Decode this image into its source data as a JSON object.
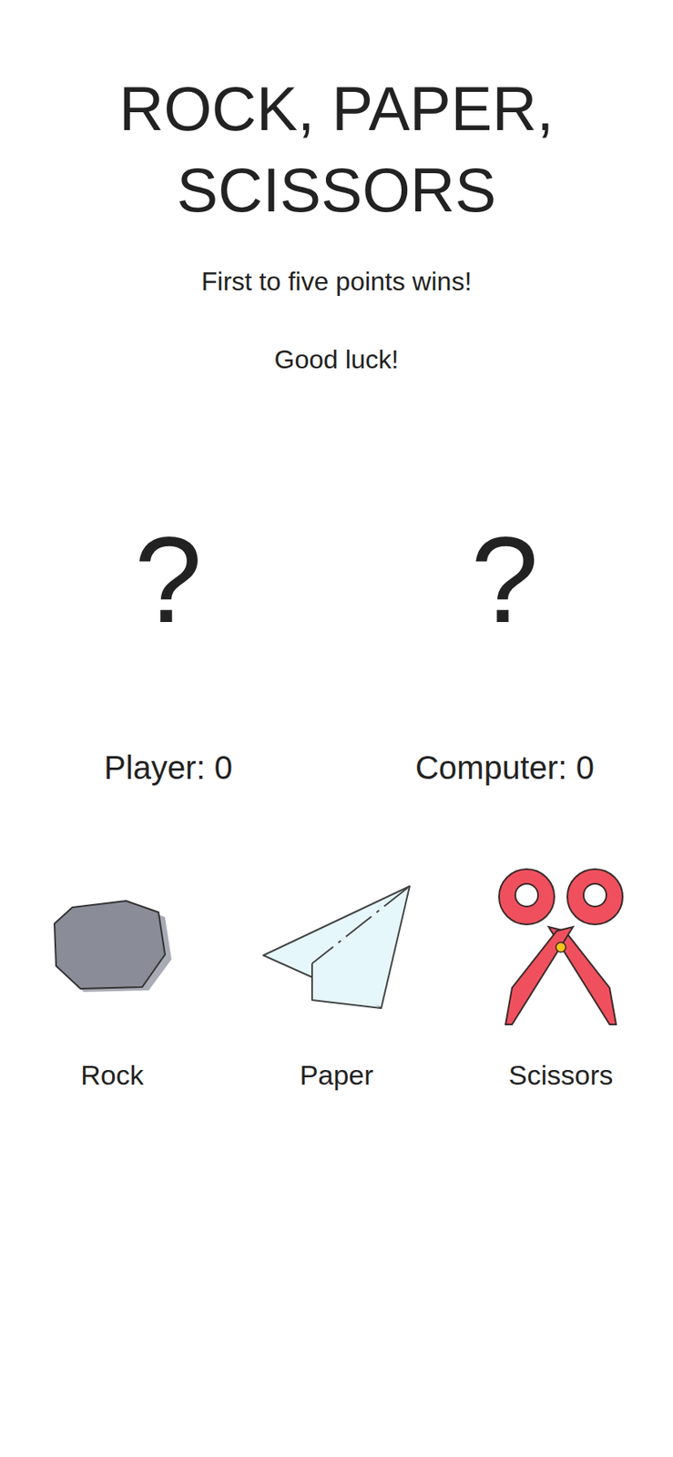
{
  "title": "ROCK, PAPER, SCISSORS",
  "intro": [
    "First to five points wins!",
    "Good luck!"
  ],
  "picks": [
    {
      "who": "player",
      "mark": "?"
    },
    {
      "who": "computer",
      "mark": "?"
    }
  ],
  "scores": [
    "Player: 0",
    "Computer: 0"
  ],
  "choices": [
    {
      "label": "Rock",
      "kind": "rock"
    },
    {
      "label": "Paper",
      "kind": "paper"
    },
    {
      "label": "Scissors",
      "kind": "scissors"
    }
  ]
}
